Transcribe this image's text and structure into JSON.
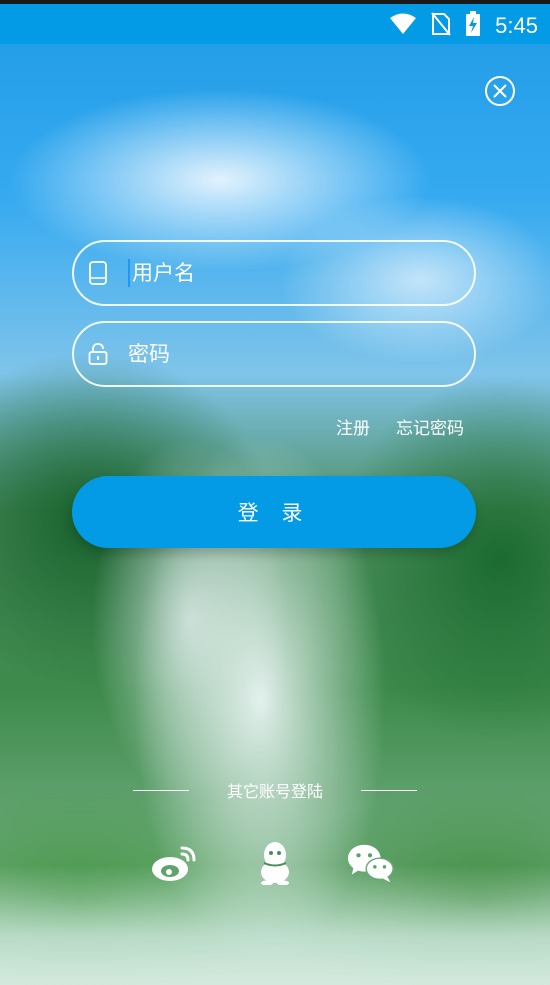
{
  "status": {
    "time": "5:45",
    "icons": [
      "wifi-icon",
      "no-sim-icon",
      "battery-charging-icon"
    ]
  },
  "close_icon": "close-icon",
  "form": {
    "username_placeholder": "用户名",
    "password_placeholder": "密码",
    "username_icon": "phone-icon",
    "password_icon": "lock-icon"
  },
  "links": {
    "register": "注册",
    "forgot_password": "忘记密码"
  },
  "login_label": "登 录",
  "other_login": {
    "label": "其它账号登陆",
    "providers": [
      "weibo-icon",
      "qq-icon",
      "wechat-icon"
    ]
  },
  "colors": {
    "primary": "#039be5",
    "status_bar": "#039be5"
  }
}
